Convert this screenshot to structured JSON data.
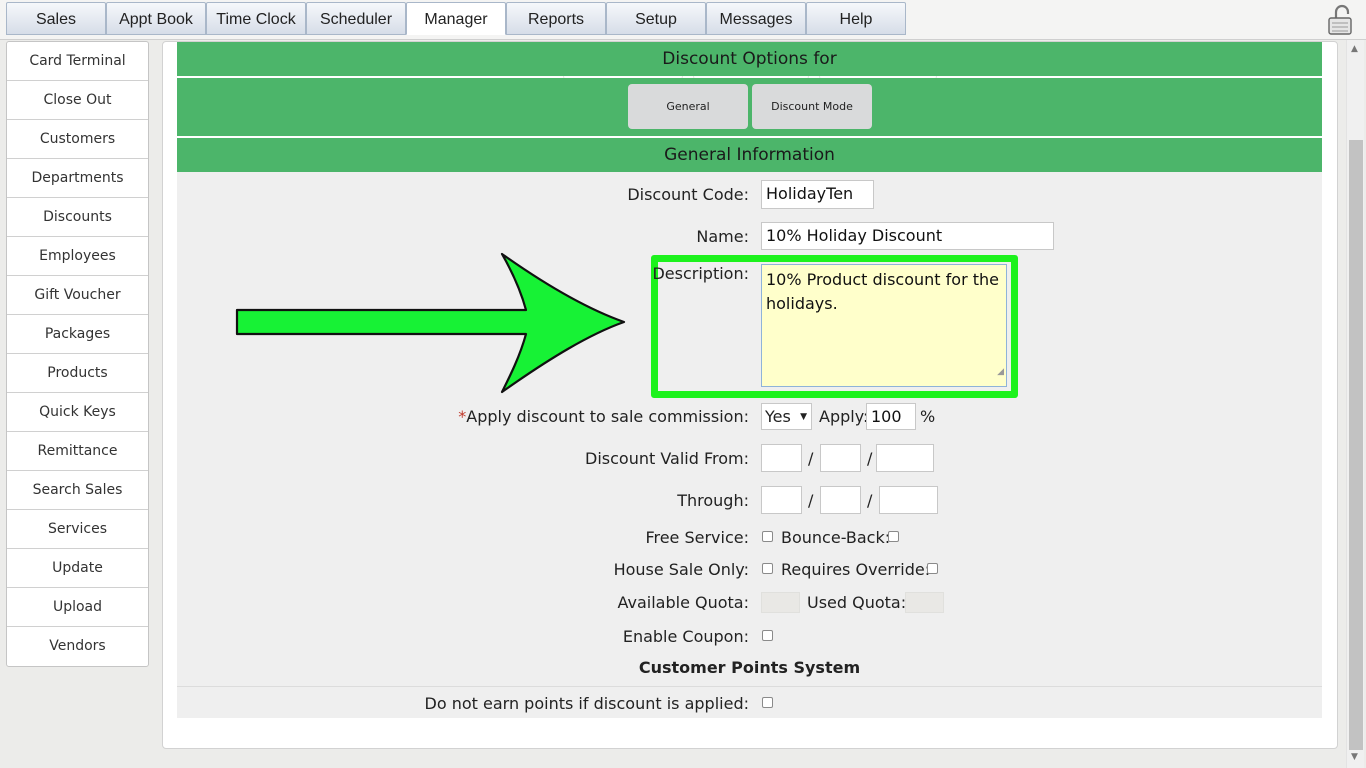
{
  "tabs": [
    {
      "label": "Sales"
    },
    {
      "label": "Appt Book"
    },
    {
      "label": "Time Clock"
    },
    {
      "label": "Scheduler"
    },
    {
      "label": "Manager"
    },
    {
      "label": "Reports"
    },
    {
      "label": "Setup"
    },
    {
      "label": "Messages"
    },
    {
      "label": "Help"
    }
  ],
  "active_tab": "Manager",
  "sidebar": {
    "items": [
      {
        "label": "Card Terminal"
      },
      {
        "label": "Close Out"
      },
      {
        "label": "Customers"
      },
      {
        "label": "Departments"
      },
      {
        "label": "Discounts"
      },
      {
        "label": "Employees"
      },
      {
        "label": "Gift Voucher"
      },
      {
        "label": "Packages"
      },
      {
        "label": "Products"
      },
      {
        "label": "Quick Keys"
      },
      {
        "label": "Remittance"
      },
      {
        "label": "Search Sales"
      },
      {
        "label": "Services"
      },
      {
        "label": "Update"
      },
      {
        "label": "Upload"
      },
      {
        "label": "Vendors"
      }
    ]
  },
  "main": {
    "options_title": "Discount Options for",
    "option_buttons": {
      "general": "General",
      "discount_mode": "Discount Mode"
    },
    "general_title": "General Information",
    "form": {
      "discount_code_label": "Discount Code:",
      "discount_code_value": "HolidayTen",
      "name_label": "Name:",
      "name_value": "10% Holiday Discount",
      "description_label": "Description:",
      "description_value": "10% Product discount for the holidays.",
      "commission_required_mark": "*",
      "commission_label": "Apply discount to sale commission:",
      "commission_value": "Yes",
      "apply_label": "Apply:",
      "apply_value": "100",
      "apply_unit": "%",
      "valid_from_label": "Discount Valid From:",
      "through_label": "Through:",
      "date_separator": "/",
      "free_service_label": "Free Service:",
      "bounce_back_label": "Bounce-Back:",
      "house_sale_label": "House Sale Only:",
      "requires_override_label": "Requires Override:",
      "available_quota_label": "Available Quota:",
      "used_quota_label": "Used Quota:",
      "enable_coupon_label": "Enable Coupon:"
    },
    "points_title": "Customer Points System",
    "points_label": "Do not earn points if discount is applied:"
  },
  "colors": {
    "header_green": "#4cb56a",
    "highlight_green": "#1df21d",
    "textarea_bg": "#ffffcb"
  },
  "icons": {
    "lock": "padlock-icon",
    "arrow": "annotation-arrow-icon",
    "select": "dropdown-arrow-icon"
  }
}
